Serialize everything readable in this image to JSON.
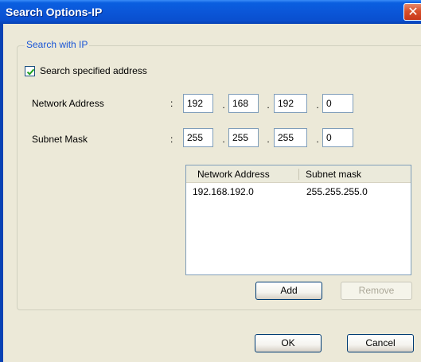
{
  "window": {
    "title": "Search Options-IP",
    "close_glyph": "✕"
  },
  "group": {
    "legend": "Search with IP"
  },
  "checkbox": {
    "label": "Search specified address",
    "checked": true
  },
  "network_address": {
    "label": "Network Address",
    "colon": ":",
    "octets": [
      "192",
      "168",
      "192",
      "0"
    ]
  },
  "subnet_mask": {
    "label": "Subnet Mask",
    "colon": ":",
    "octets": [
      "255",
      "255",
      "255",
      "0"
    ]
  },
  "ip_separator": ".",
  "list": {
    "columns": [
      "Network Address",
      "Subnet mask"
    ],
    "rows": [
      {
        "network_address": "192.168.192.0",
        "subnet_mask": "255.255.255.0"
      }
    ]
  },
  "buttons": {
    "add": "Add",
    "remove": "Remove",
    "ok": "OK",
    "cancel": "Cancel"
  },
  "colors": {
    "title_bar": "#0a56d8",
    "legend_text": "#1a56d6",
    "dialog_bg": "#ece9d8"
  }
}
